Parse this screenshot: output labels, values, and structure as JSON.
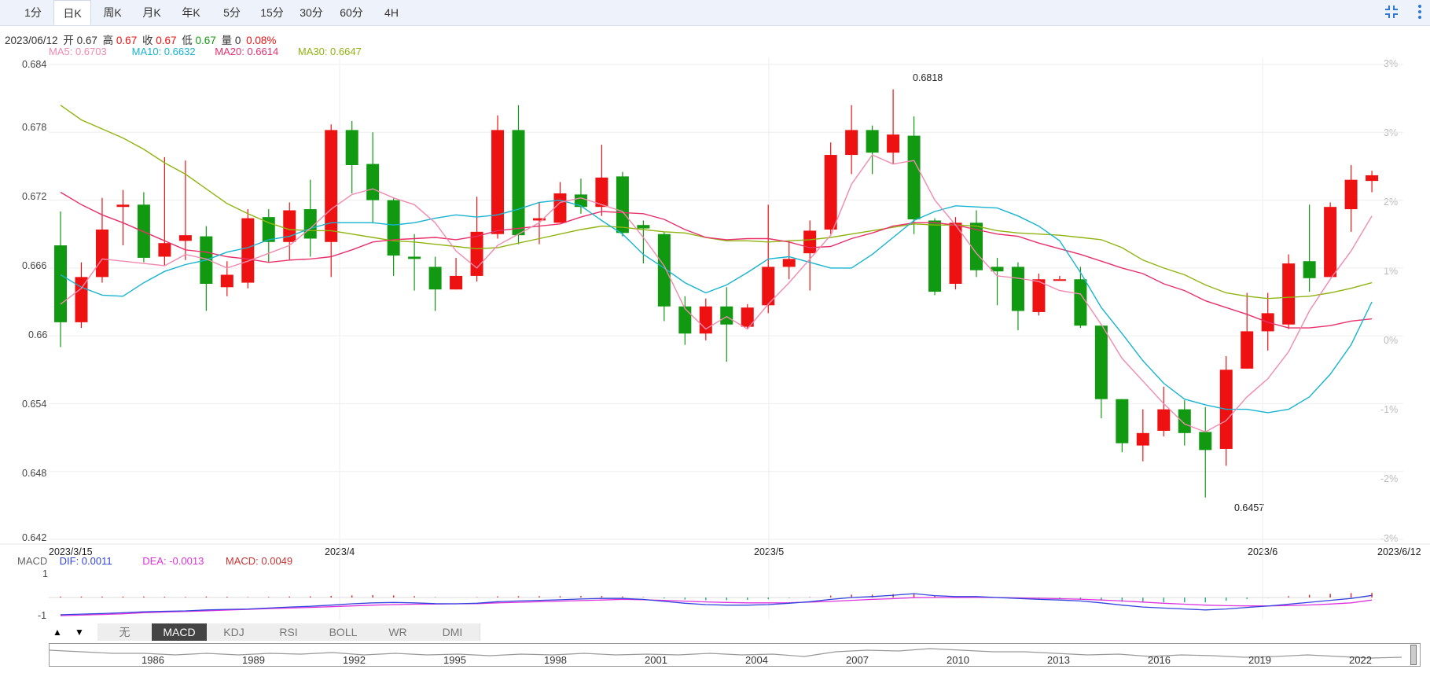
{
  "toolbar": {
    "tabs": [
      "1分",
      "日K",
      "周K",
      "月K",
      "年K",
      "5分",
      "15分",
      "30分",
      "60分",
      "4H"
    ],
    "active_tab": "日K",
    "icons": [
      "fullscreen-exit-icon",
      "more-vertical-icon"
    ]
  },
  "info": {
    "date": "2023/06/12",
    "open_label": "开",
    "open": "0.67",
    "high_label": "高",
    "high": "0.67",
    "close_label": "收",
    "close": "0.67",
    "low_label": "低",
    "low": "0.67",
    "vol_label": "量",
    "vol": "0",
    "change": "0.08%"
  },
  "ma_legend": {
    "ma5": "MA5: 0.6703",
    "ma10": "MA10: 0.6632",
    "ma20": "MA20: 0.6614",
    "ma30": "MA30: 0.6647"
  },
  "colors": {
    "up": "#ee1111",
    "down": "#119911",
    "ma5": "#f08ab0",
    "ma10": "#17b3d2",
    "ma20": "#e8306a",
    "ma30": "#8fb410",
    "dif": "#3344dd",
    "dea": "#dd33dd",
    "macd": "#cc3333"
  },
  "macd_legend": {
    "label": "MACD",
    "dif": "DIF: 0.0011",
    "dea": "DEA: -0.0013",
    "macd": "MACD: 0.0049",
    "top": "1",
    "bottom": "-1"
  },
  "indicator_tabs": [
    "无",
    "MACD",
    "KDJ",
    "RSI",
    "BOLL",
    "WR",
    "DMI"
  ],
  "active_indicator": "MACD",
  "nav": {
    "years": [
      "1986",
      "1989",
      "1992",
      "1995",
      "1998",
      "2001",
      "2004",
      "2007",
      "2010",
      "2013",
      "2016",
      "2019",
      "2022"
    ]
  },
  "chart_data": {
    "type": "candlestick",
    "y_ticks": [
      "0.684",
      "0.678",
      "0.672",
      "0.666",
      "0.66",
      "0.654",
      "0.648",
      "0.642"
    ],
    "ylim": [
      0.642,
      0.684
    ],
    "pct_ticks": [
      "3%",
      "3%",
      "2%",
      "1%",
      "0%",
      "-1%",
      "-2%",
      "-3%"
    ],
    "x_labels": [
      "2023/3/15",
      "2023/4",
      "2023/5",
      "2023/6",
      "2023/6/12"
    ],
    "annotations": {
      "max": "0.6818",
      "min": "0.6457"
    },
    "candles": [
      [
        0.668,
        0.6612,
        0.671,
        0.659
      ],
      [
        0.6612,
        0.6652,
        0.6665,
        0.6607
      ],
      [
        0.6652,
        0.6694,
        0.6722,
        0.6647
      ],
      [
        0.6714,
        0.6716,
        0.6729,
        0.668
      ],
      [
        0.6716,
        0.6669,
        0.6727,
        0.6665
      ],
      [
        0.667,
        0.6682,
        0.6758,
        0.6662
      ],
      [
        0.6684,
        0.6689,
        0.6755,
        0.6667
      ],
      [
        0.6688,
        0.6646,
        0.6697,
        0.6622
      ],
      [
        0.6643,
        0.6654,
        0.6666,
        0.6635
      ],
      [
        0.6647,
        0.6704,
        0.6712,
        0.6642
      ],
      [
        0.6705,
        0.6683,
        0.6712,
        0.6665
      ],
      [
        0.6683,
        0.6711,
        0.6718,
        0.6667
      ],
      [
        0.6712,
        0.6686,
        0.6738,
        0.667
      ],
      [
        0.6683,
        0.6782,
        0.6787,
        0.6652
      ],
      [
        0.6782,
        0.6751,
        0.679,
        0.6726
      ],
      [
        0.6752,
        0.672,
        0.678,
        0.67
      ],
      [
        0.672,
        0.6671,
        0.6722,
        0.6653
      ],
      [
        0.667,
        0.6668,
        0.669,
        0.664
      ],
      [
        0.6661,
        0.6641,
        0.667,
        0.6622
      ],
      [
        0.6641,
        0.6653,
        0.6669,
        0.6641
      ],
      [
        0.6653,
        0.6692,
        0.6723,
        0.6648
      ],
      [
        0.669,
        0.6782,
        0.6795,
        0.6686
      ],
      [
        0.6782,
        0.6689,
        0.6804,
        0.6681
      ],
      [
        0.6702,
        0.6704,
        0.6718,
        0.6681
      ],
      [
        0.67,
        0.6726,
        0.6736,
        0.67
      ],
      [
        0.6725,
        0.6714,
        0.6739,
        0.6708
      ],
      [
        0.6714,
        0.674,
        0.6769,
        0.6706
      ],
      [
        0.6741,
        0.6691,
        0.6745,
        0.6688
      ],
      [
        0.6698,
        0.6695,
        0.6702,
        0.6664
      ],
      [
        0.669,
        0.6626,
        0.6692,
        0.6613
      ],
      [
        0.6626,
        0.6602,
        0.6635,
        0.6592
      ],
      [
        0.6602,
        0.6626,
        0.6633,
        0.6596
      ],
      [
        0.6626,
        0.661,
        0.6643,
        0.6577
      ],
      [
        0.6608,
        0.6625,
        0.6628,
        0.6606
      ],
      [
        0.6627,
        0.6661,
        0.6716,
        0.662
      ],
      [
        0.6661,
        0.6668,
        0.6684,
        0.665
      ],
      [
        0.6673,
        0.6693,
        0.6702,
        0.664
      ],
      [
        0.6694,
        0.676,
        0.6771,
        0.669
      ],
      [
        0.676,
        0.6782,
        0.6804,
        0.6743
      ],
      [
        0.6782,
        0.6762,
        0.6786,
        0.6743
      ],
      [
        0.6762,
        0.6778,
        0.6818,
        0.6752
      ],
      [
        0.6777,
        0.6703,
        0.6794,
        0.669
      ],
      [
        0.6702,
        0.6639,
        0.6704,
        0.6636
      ],
      [
        0.6646,
        0.67,
        0.6705,
        0.6641
      ],
      [
        0.67,
        0.6658,
        0.6711,
        0.6652
      ],
      [
        0.6661,
        0.6657,
        0.6669,
        0.6627
      ],
      [
        0.6661,
        0.6622,
        0.6665,
        0.6605
      ],
      [
        0.6621,
        0.665,
        0.6655,
        0.6618
      ],
      [
        0.665,
        0.665,
        0.6653,
        0.665
      ],
      [
        0.665,
        0.6609,
        0.6661,
        0.6607
      ],
      [
        0.6609,
        0.6544,
        0.6609,
        0.6527
      ],
      [
        0.6544,
        0.6505,
        0.6544,
        0.6497
      ],
      [
        0.6503,
        0.6514,
        0.6535,
        0.6489
      ],
      [
        0.6516,
        0.6535,
        0.6555,
        0.6511
      ],
      [
        0.6535,
        0.6514,
        0.6543,
        0.6503
      ],
      [
        0.6515,
        0.6499,
        0.6537,
        0.6457
      ],
      [
        0.65,
        0.657,
        0.6582,
        0.6485
      ],
      [
        0.6571,
        0.6604,
        0.6638,
        0.6571
      ],
      [
        0.6604,
        0.662,
        0.6638,
        0.6587
      ],
      [
        0.661,
        0.6664,
        0.6672,
        0.6606
      ],
      [
        0.6666,
        0.6651,
        0.6716,
        0.6639
      ],
      [
        0.6652,
        0.6714,
        0.6718,
        0.6652
      ],
      [
        0.6712,
        0.6738,
        0.6751,
        0.6692
      ],
      [
        0.6737,
        0.6742,
        0.6746,
        0.6727
      ]
    ],
    "ma5": [
      0.6628,
      0.6642,
      0.6668,
      0.6666,
      0.6664,
      0.6662,
      0.6672,
      0.6668,
      0.666,
      0.6666,
      0.6673,
      0.668,
      0.6695,
      0.6712,
      0.6725,
      0.673,
      0.6722,
      0.6716,
      0.67,
      0.6675,
      0.666,
      0.668,
      0.669,
      0.67,
      0.6718,
      0.6722,
      0.6716,
      0.671,
      0.6687,
      0.6662,
      0.6624,
      0.6606,
      0.6617,
      0.6606,
      0.6628,
      0.6647,
      0.6668,
      0.6689,
      0.6734,
      0.676,
      0.6752,
      0.6755,
      0.672,
      0.6698,
      0.6673,
      0.6653,
      0.6651,
      0.6648,
      0.664,
      0.6637,
      0.661,
      0.658,
      0.656,
      0.654,
      0.6522,
      0.6515,
      0.6525,
      0.6546,
      0.6562,
      0.6586,
      0.6622,
      0.665,
      0.6675,
      0.6706
    ],
    "ma10": [
      0.6654,
      0.6643,
      0.6636,
      0.6635,
      0.6647,
      0.6657,
      0.6663,
      0.6667,
      0.6674,
      0.6678,
      0.6685,
      0.6688,
      0.6695,
      0.67,
      0.67,
      0.67,
      0.6698,
      0.67,
      0.6704,
      0.6707,
      0.6705,
      0.6707,
      0.6712,
      0.6718,
      0.672,
      0.6715,
      0.6702,
      0.669,
      0.6672,
      0.666,
      0.6647,
      0.6638,
      0.6645,
      0.6656,
      0.6668,
      0.667,
      0.6665,
      0.666,
      0.666,
      0.6672,
      0.6687,
      0.6702,
      0.671,
      0.6715,
      0.6714,
      0.6713,
      0.6706,
      0.6697,
      0.6684,
      0.6656,
      0.6625,
      0.6602,
      0.6578,
      0.6558,
      0.6544,
      0.6539,
      0.6535,
      0.6535,
      0.6532,
      0.6535,
      0.6546,
      0.6566,
      0.6592,
      0.663
    ],
    "ma20": [
      0.6727,
      0.6716,
      0.6707,
      0.67,
      0.6692,
      0.6684,
      0.6676,
      0.6674,
      0.667,
      0.6668,
      0.6665,
      0.6667,
      0.6668,
      0.667,
      0.6676,
      0.6683,
      0.6685,
      0.6686,
      0.6687,
      0.6685,
      0.6688,
      0.6693,
      0.6695,
      0.6697,
      0.6699,
      0.6705,
      0.671,
      0.6709,
      0.6708,
      0.6703,
      0.6694,
      0.6687,
      0.6685,
      0.6686,
      0.6686,
      0.6683,
      0.6678,
      0.6679,
      0.6686,
      0.6691,
      0.6697,
      0.67,
      0.67,
      0.6698,
      0.6694,
      0.669,
      0.6688,
      0.6682,
      0.6677,
      0.6672,
      0.6666,
      0.666,
      0.6655,
      0.6646,
      0.664,
      0.6631,
      0.6625,
      0.6619,
      0.6612,
      0.6607,
      0.6607,
      0.6609,
      0.6613,
      0.6615
    ],
    "ma30": [
      0.6804,
      0.6791,
      0.6783,
      0.6775,
      0.6765,
      0.6753,
      0.6743,
      0.673,
      0.6717,
      0.6708,
      0.67,
      0.6694,
      0.6693,
      0.6693,
      0.669,
      0.6687,
      0.6684,
      0.6683,
      0.6681,
      0.6679,
      0.6677,
      0.6678,
      0.6682,
      0.6686,
      0.669,
      0.6694,
      0.6697,
      0.6696,
      0.6694,
      0.6692,
      0.6691,
      0.6687,
      0.6684,
      0.6684,
      0.6683,
      0.6684,
      0.6685,
      0.6687,
      0.669,
      0.6693,
      0.6696,
      0.6699,
      0.6698,
      0.6698,
      0.6697,
      0.6693,
      0.6691,
      0.669,
      0.6689,
      0.6687,
      0.6685,
      0.6678,
      0.6667,
      0.666,
      0.6654,
      0.6645,
      0.6638,
      0.6635,
      0.6633,
      0.6634,
      0.6635,
      0.6638,
      0.6642,
      0.6647
    ],
    "macd_ylim": [
      -1,
      1
    ],
    "dif": [
      -0.9,
      -0.87,
      -0.84,
      -0.8,
      -0.75,
      -0.72,
      -0.7,
      -0.65,
      -0.62,
      -0.6,
      -0.55,
      -0.5,
      -0.46,
      -0.4,
      -0.33,
      -0.28,
      -0.26,
      -0.28,
      -0.32,
      -0.33,
      -0.3,
      -0.22,
      -0.18,
      -0.15,
      -0.12,
      -0.08,
      -0.05,
      -0.05,
      -0.1,
      -0.2,
      -0.3,
      -0.37,
      -0.4,
      -0.4,
      -0.37,
      -0.3,
      -0.22,
      -0.1,
      0.0,
      0.05,
      0.12,
      0.2,
      0.1,
      0.05,
      0.05,
      0.0,
      -0.05,
      -0.1,
      -0.13,
      -0.18,
      -0.28,
      -0.4,
      -0.5,
      -0.55,
      -0.6,
      -0.65,
      -0.6,
      -0.52,
      -0.45,
      -0.35,
      -0.25,
      -0.15,
      -0.05,
      0.11
    ],
    "dea": [
      -0.95,
      -0.92,
      -0.89,
      -0.85,
      -0.8,
      -0.76,
      -0.73,
      -0.7,
      -0.66,
      -0.62,
      -0.58,
      -0.55,
      -0.52,
      -0.48,
      -0.44,
      -0.4,
      -0.37,
      -0.35,
      -0.34,
      -0.33,
      -0.32,
      -0.28,
      -0.25,
      -0.22,
      -0.19,
      -0.16,
      -0.13,
      -0.1,
      -0.12,
      -0.15,
      -0.19,
      -0.23,
      -0.26,
      -0.28,
      -0.28,
      -0.27,
      -0.24,
      -0.2,
      -0.15,
      -0.1,
      -0.06,
      -0.01,
      0.0,
      0.0,
      0.01,
      0.0,
      -0.02,
      -0.04,
      -0.06,
      -0.09,
      -0.13,
      -0.18,
      -0.24,
      -0.3,
      -0.35,
      -0.4,
      -0.43,
      -0.44,
      -0.44,
      -0.42,
      -0.39,
      -0.34,
      -0.28,
      -0.13
    ],
    "macd_bars": [
      0.1,
      0.1,
      0.1,
      0.1,
      0.1,
      0.08,
      0.06,
      0.1,
      0.08,
      0.04,
      0.06,
      0.1,
      0.12,
      0.16,
      0.22,
      0.24,
      0.22,
      0.14,
      0.04,
      0.0,
      0.04,
      0.12,
      0.14,
      0.14,
      0.14,
      0.16,
      0.16,
      0.1,
      0.04,
      -0.1,
      -0.22,
      -0.28,
      -0.28,
      -0.24,
      -0.18,
      -0.06,
      0.04,
      0.2,
      0.3,
      0.3,
      0.36,
      0.42,
      0.2,
      0.1,
      0.08,
      0.0,
      -0.06,
      -0.12,
      -0.14,
      -0.18,
      -0.3,
      -0.44,
      -0.52,
      -0.5,
      -0.5,
      -0.5,
      -0.34,
      -0.16,
      -0.02,
      0.14,
      0.28,
      0.38,
      0.46,
      0.48
    ]
  }
}
